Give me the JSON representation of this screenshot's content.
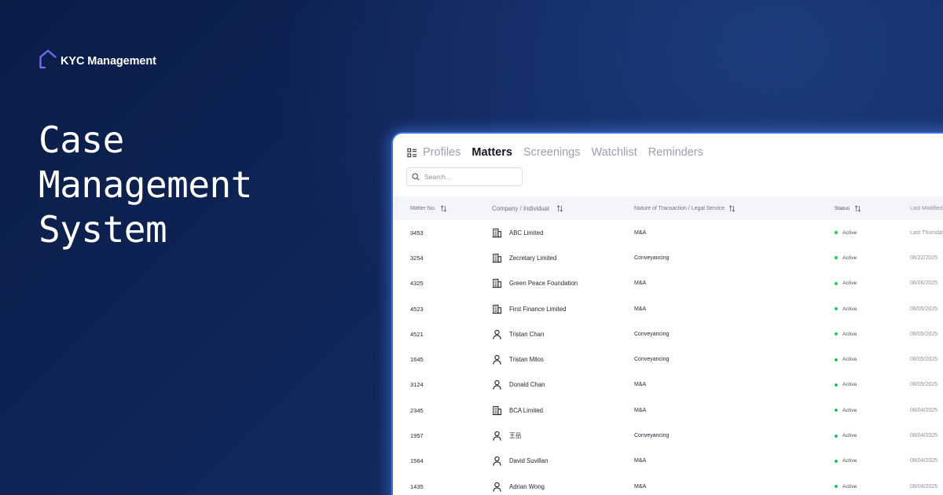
{
  "brand": {
    "name": "KYC Management"
  },
  "hero": {
    "line1": "Case",
    "line2": "Management",
    "line3": "System"
  },
  "tabs": [
    {
      "label": "Profiles",
      "active": false
    },
    {
      "label": "Matters",
      "active": true
    },
    {
      "label": "Screenings",
      "active": false
    },
    {
      "label": "Watchlist",
      "active": false
    },
    {
      "label": "Reminders",
      "active": false
    }
  ],
  "search": {
    "placeholder": "Search..."
  },
  "table": {
    "headers": {
      "matter_no": "Matter No.",
      "company": "Company / Individual",
      "nature": "Nature of Transaction / Legal Service",
      "status": "Status",
      "last_modified": "Last Modified"
    },
    "rows": [
      {
        "matter_no": "3453",
        "type": "company",
        "name": "ABC Limited",
        "nature": "M&A",
        "status": "Active",
        "last_modified": "Last Thursday"
      },
      {
        "matter_no": "3254",
        "type": "company",
        "name": "Zecretary Limited",
        "nature": "Conveyancing",
        "status": "Active",
        "last_modified": "08/22/2025"
      },
      {
        "matter_no": "4325",
        "type": "company",
        "name": "Green Peace Foundation",
        "nature": "M&A",
        "status": "Active",
        "last_modified": "08/06/2025"
      },
      {
        "matter_no": "4523",
        "type": "company",
        "name": "First Finance Limited",
        "nature": "M&A",
        "status": "Active",
        "last_modified": "08/05/2025"
      },
      {
        "matter_no": "4521",
        "type": "individual",
        "name": "Tristan Chan",
        "nature": "Conveyancing",
        "status": "Active",
        "last_modified": "08/05/2025"
      },
      {
        "matter_no": "1645",
        "type": "individual",
        "name": "Tristan Milos",
        "nature": "Conveyancing",
        "status": "Active",
        "last_modified": "08/05/2025"
      },
      {
        "matter_no": "3124",
        "type": "individual",
        "name": "Donald Chan",
        "nature": "M&A",
        "status": "Active",
        "last_modified": "08/05/2025"
      },
      {
        "matter_no": "2345",
        "type": "company",
        "name": "BCA Limited",
        "nature": "M&A",
        "status": "Active",
        "last_modified": "08/04/2025"
      },
      {
        "matter_no": "1957",
        "type": "individual",
        "name": "王岳",
        "nature": "Conveyancing",
        "status": "Active",
        "last_modified": "08/04/2025"
      },
      {
        "matter_no": "1564",
        "type": "individual",
        "name": "David Suvillan",
        "nature": "M&A",
        "status": "Active",
        "last_modified": "08/04/2025"
      },
      {
        "matter_no": "1435",
        "type": "individual",
        "name": "Adrian Wong",
        "nature": "M&A",
        "status": "Active",
        "last_modified": "08/04/2025"
      }
    ]
  },
  "colors": {
    "accent": "#6d5dfc",
    "status_active": "#22c55e",
    "panel_glow": "#3b6fe0"
  },
  "icons": {
    "brand": "house-outline-icon",
    "tabs": "list-layout-icon",
    "search": "search-icon",
    "sort": "sort-arrows-icon",
    "company": "building-icon",
    "individual": "person-icon"
  }
}
